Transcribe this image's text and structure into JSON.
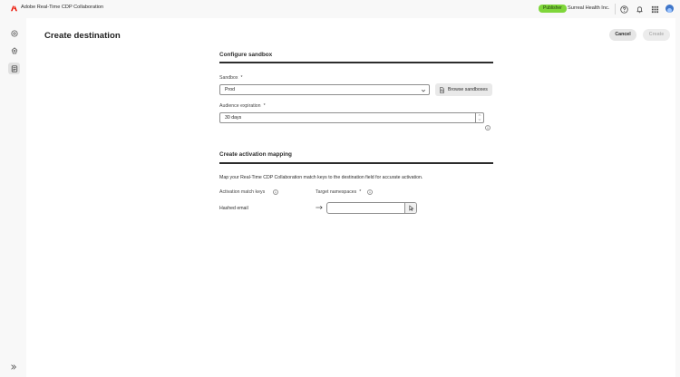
{
  "app": {
    "title": "Adobe Real-Time CDP Collaboration",
    "role_badge": "Publisher",
    "org_name": "Surreal Health Inc.",
    "brand_color": "#eb1000"
  },
  "top_icons": [
    "help-icon",
    "notifications-icon",
    "apps-icon",
    "avatar"
  ],
  "rail": {
    "items": [
      {
        "name": "home-icon",
        "active": false
      },
      {
        "name": "collaboration-icon",
        "active": false
      },
      {
        "name": "destinations-icon",
        "active": true
      }
    ],
    "expand_icon": "chevron-double-right-icon"
  },
  "page": {
    "title": "Create destination",
    "cancel_label": "Cancel",
    "create_label": "Create"
  },
  "sandbox_section": {
    "title": "Configure sandbox",
    "sandbox_label": "Sandbox",
    "required_mark": "*",
    "sandbox_value": "Prod",
    "browse_label": "Browse sandboxes",
    "expiration_label": "Audience expiration",
    "expiration_value": "30 days"
  },
  "mapping_section": {
    "title": "Create activation mapping",
    "description": "Map your Real-Time CDP Collaboration match keys to the destination field for accurate activation.",
    "match_keys_label": "Activation match keys",
    "target_label": "Target namespaces",
    "required_mark": "*",
    "row_source": "Hashed email",
    "row_target_value": ""
  }
}
